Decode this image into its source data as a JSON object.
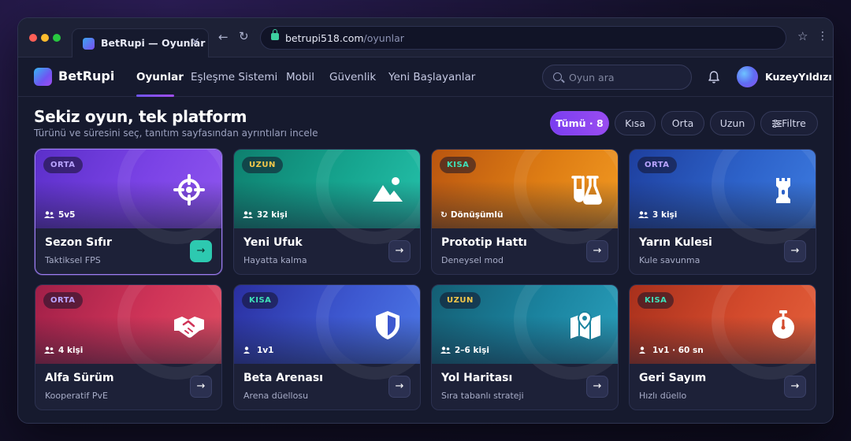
{
  "browser": {
    "tab_title": "BetRupi — Oyunlar",
    "tab_close": "×",
    "url_host": "betrupi518.com",
    "url_path": "/oyunlar",
    "back": "←",
    "reload": "↻",
    "bookmark": "☆",
    "menu": "⋮"
  },
  "header": {
    "brand": "BetRupi",
    "nav": [
      "Oyunlar",
      "Eşleşme Sistemi",
      "Mobil",
      "Güvenlik",
      "Yeni Başlayanlar"
    ],
    "active_nav": "Oyunlar",
    "search_placeholder": "Oyun ara",
    "username": "KuzeyYıldızı"
  },
  "page": {
    "title": "Sekiz oyun, tek platform",
    "subtitle": "Türünü ve süresini seç, tanıtım sayfasından ayrıntıları incele",
    "filters": [
      "Tümü · 8",
      "Kısa",
      "Orta",
      "Uzun",
      "Filtre"
    ],
    "active_filter": "Tümü · 8"
  },
  "colors": {
    "accent": "#7a3ef0",
    "badge_orta": "#b9a4ff",
    "badge_uzun": "#f5c84a",
    "badge_kisa": "#3fe0b8"
  },
  "cards": [
    {
      "badge": "ORTA",
      "meta": "5v5",
      "meta_icon": "users-icon",
      "title": "Sezon Sıfır",
      "subtitle": "Taktiksel FPS",
      "icon": "crosshair-icon",
      "arrow": "→"
    },
    {
      "badge": "UZUN",
      "meta": "32 kişi",
      "meta_icon": "users-icon",
      "title": "Yeni Ufuk",
      "subtitle": "Hayatta kalma",
      "icon": "landscape-icon",
      "arrow": "→"
    },
    {
      "badge": "KISA",
      "meta": "Dönüşümlü",
      "meta_icon": "rotate-icon",
      "title": "Prototip Hattı",
      "subtitle": "Deneysel mod",
      "icon": "flask-icon",
      "arrow": "→"
    },
    {
      "badge": "ORTA",
      "meta": "3 kişi",
      "meta_icon": "users-icon",
      "title": "Yarın Kulesi",
      "subtitle": "Kule savunma",
      "icon": "tower-icon",
      "arrow": "→"
    },
    {
      "badge": "ORTA",
      "meta": "4 kişi",
      "meta_icon": "users-icon",
      "title": "Alfa Sürüm",
      "subtitle": "Kooperatif PvE",
      "icon": "handshake-icon",
      "arrow": "→"
    },
    {
      "badge": "KISA",
      "meta": "1v1",
      "meta_icon": "user-icon",
      "title": "Beta Arenası",
      "subtitle": "Arena düellosu",
      "icon": "shield-icon",
      "arrow": "→"
    },
    {
      "badge": "UZUN",
      "meta": "2–6 kişi",
      "meta_icon": "users-icon",
      "title": "Yol Haritası",
      "subtitle": "Sıra tabanlı strateji",
      "icon": "map-icon",
      "arrow": "→"
    },
    {
      "badge": "KISA",
      "meta": "1v1 · 60 sn",
      "meta_icon": "user-icon",
      "title": "Geri Sayım",
      "subtitle": "Hızlı düello",
      "icon": "stopwatch-icon",
      "arrow": "→"
    }
  ]
}
